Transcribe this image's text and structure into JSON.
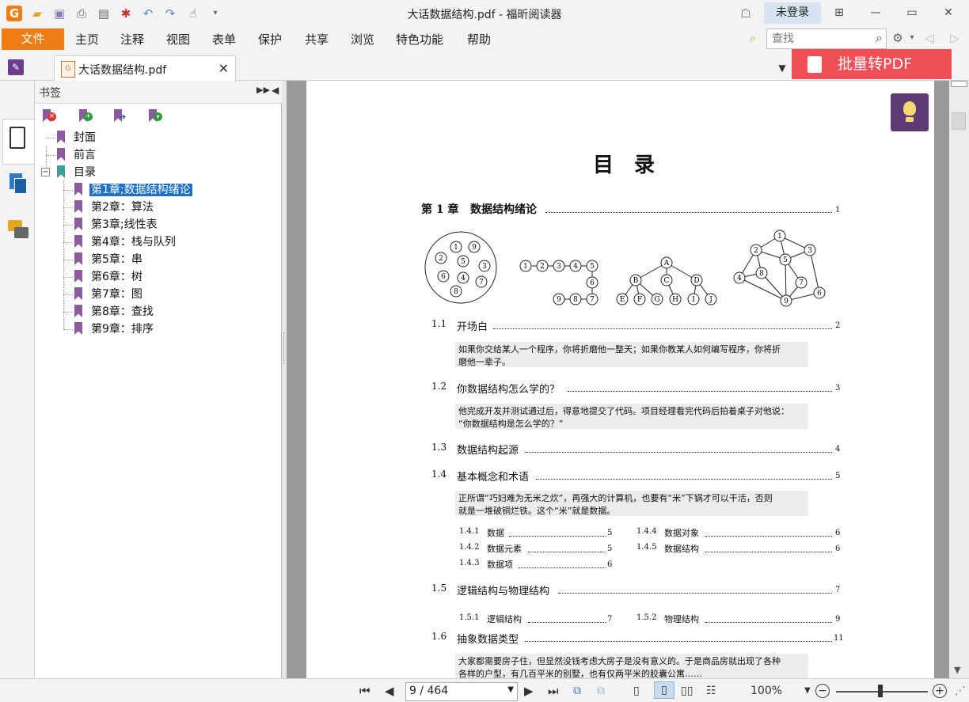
{
  "window": {
    "title": "大话数据结构.pdf - 福昕阅读器",
    "login_label": "未登录"
  },
  "menu": {
    "file": "文件",
    "items": [
      "主页",
      "注释",
      "视图",
      "表单",
      "保护",
      "共享",
      "浏览",
      "特色功能",
      "帮助"
    ],
    "search_placeholder": "查找"
  },
  "tab": {
    "label": "大话数据结构.pdf",
    "close": "✕",
    "batch_label": "批量转PDF"
  },
  "bookmarks": {
    "title": "书签",
    "items": [
      {
        "label": "封面"
      },
      {
        "label": "前言"
      },
      {
        "label": "目录",
        "expanded": true
      },
      {
        "label": "第1章;数据结构绪论",
        "selected": true
      },
      {
        "label": "第2章：算法"
      },
      {
        "label": "第3章;线性表"
      },
      {
        "label": "第4章：栈与队列"
      },
      {
        "label": "第5章：串"
      },
      {
        "label": "第6章：树"
      },
      {
        "label": "第7章：图"
      },
      {
        "label": "第8章：查找"
      },
      {
        "label": "第9章：排序"
      }
    ]
  },
  "page": {
    "heading": "目　录",
    "chapter": {
      "label": "第 1 章",
      "title": "数据结构绪论",
      "page": "1"
    },
    "diagram_nodes": {
      "set": [
        "1",
        "9",
        "2",
        "5",
        "3",
        "6",
        "4",
        "7",
        "8"
      ],
      "list": [
        "1",
        "2",
        "3",
        "4",
        "5",
        "6",
        "9",
        "8",
        "7"
      ],
      "tree": [
        "A",
        "B",
        "C",
        "D",
        "E",
        "F",
        "G",
        "H",
        "I",
        "J"
      ],
      "graph": [
        "1",
        "2",
        "3",
        "5",
        "8",
        "4",
        "7",
        "9",
        "6"
      ]
    },
    "sections": [
      {
        "num": "1.1",
        "title": "开场白",
        "page": "2",
        "quote": [
          "如果你交给某人一个程序，你将折磨他一整天；如果你教某人如何编写程序，你将折",
          "磨他一辈子。"
        ]
      },
      {
        "num": "1.2",
        "title": "你数据结构怎么学的？",
        "page": "3",
        "quote": [
          "他完成开发并测试通过后，得意地提交了代码。项目经理看完代码后拍着桌子对他说：",
          "“你数据结构是怎么学的？”"
        ]
      },
      {
        "num": "1.3",
        "title": "数据结构起源",
        "page": "4"
      },
      {
        "num": "1.4",
        "title": "基本概念和术语",
        "page": "5",
        "quote": [
          "正所谓“巧妇难为无米之炊”，再强大的计算机，也要有“米”下锅才可以干活，否则",
          "就是一堆破铜烂铁。这个“米”就是数据。"
        ]
      },
      {
        "num": "1.5",
        "title": "逻辑结构与物理结构",
        "page": "7"
      },
      {
        "num": "1.6",
        "title": "抽象数据类型",
        "page": "11",
        "quote": [
          "大家都需要房子住，但显然没钱考虑大房子是没有意义的。于是商品房就出现了各种",
          "各样的户型，有几百平米的别墅，也有仅两平米的胶囊公寓……"
        ]
      }
    ],
    "subsections_14": [
      {
        "num": "1.4.1",
        "title": "数据",
        "page": "5"
      },
      {
        "num": "1.4.4",
        "title": "数据对象",
        "page": "6"
      },
      {
        "num": "1.4.2",
        "title": "数据元素",
        "page": "5"
      },
      {
        "num": "1.4.5",
        "title": "数据结构",
        "page": "6"
      },
      {
        "num": "1.4.3",
        "title": "数据项",
        "page": "6"
      }
    ],
    "subsections_15": [
      {
        "num": "1.5.1",
        "title": "逻辑结构",
        "page": "7"
      },
      {
        "num": "1.5.2",
        "title": "物理结构",
        "page": "9"
      }
    ]
  },
  "status": {
    "page_indicator": "9 / 464",
    "zoom": "100%"
  }
}
